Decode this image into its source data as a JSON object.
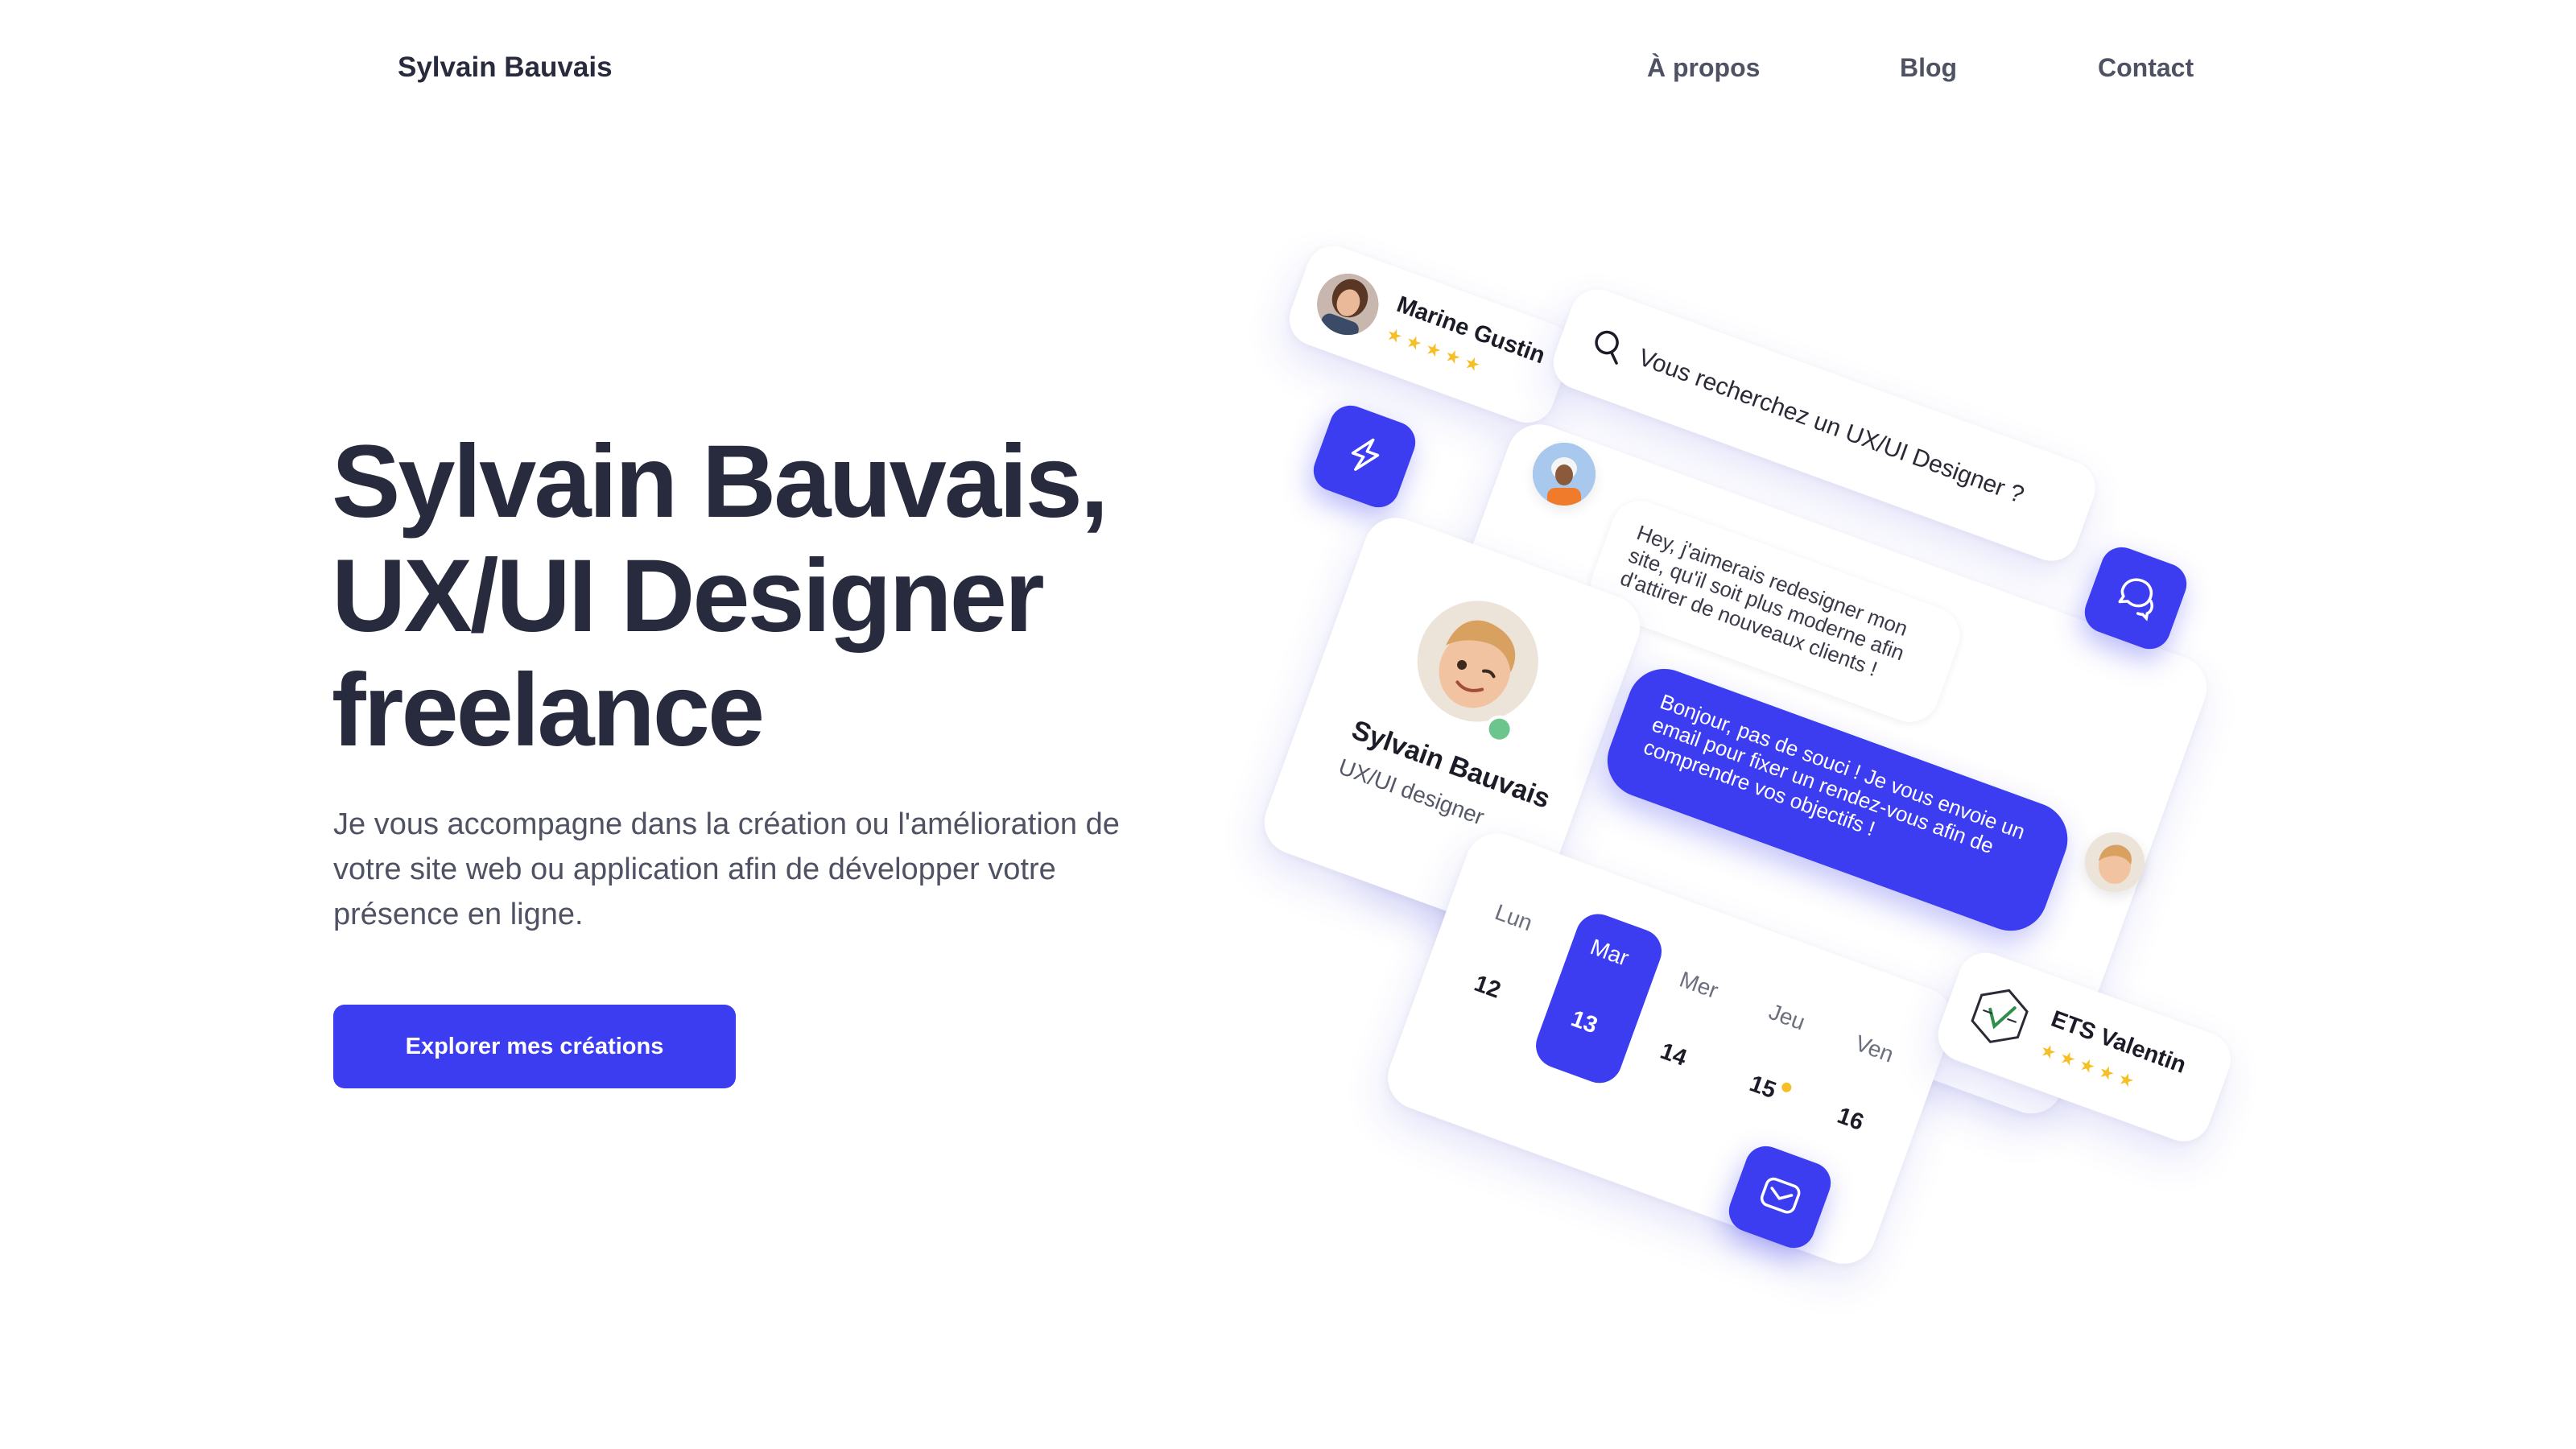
{
  "header": {
    "brand": "Sylvain Bauvais",
    "nav": [
      "À propos",
      "Blog",
      "Contact"
    ]
  },
  "hero": {
    "title_lines": [
      "Sylvain Bauvais,",
      "UX/UI Designer",
      "freelance"
    ],
    "subtitle": "Je vous accompagne dans la création ou l'amélioration de votre site web ou application afin de développer votre présence en ligne.",
    "cta_label": "Explorer mes créations"
  },
  "illustration": {
    "review_top": {
      "name": "Marine Gustin",
      "stars": "★★★★★",
      "rating": 5
    },
    "search": {
      "text": "Vous recherchez un UX/UI Designer ?",
      "icon": "search-icon"
    },
    "profile": {
      "name": "Sylvain Bauvais",
      "role": "UX/UI designer",
      "status": "online"
    },
    "message_in": "Hey, j'aimerais redesigner mon site, qu'il soit plus moderne afin d'attirer de nouveaux clients !",
    "message_out": "Bonjour, pas de souci ! Je vous envoie un email pour fixer un rendez-vous afin de comprendre vos objectifs !",
    "calendar": {
      "days": [
        "Lun",
        "Mar",
        "Mer",
        "Jeu",
        "Ven"
      ],
      "dates": [
        "12",
        "13",
        "14",
        "15",
        "16"
      ],
      "selected": "13"
    },
    "review_bottom": {
      "name": "ETS Valentin",
      "stars": "★★★★★",
      "rating": 5
    },
    "icons": [
      "lightning-icon",
      "chat-bubbles-icon",
      "mail-icon"
    ]
  },
  "colors": {
    "accent": "#3c3cf0",
    "text_dark": "#282a3d",
    "text_muted": "#4f5262",
    "star": "#f6bf26",
    "online": "#6cc58d"
  }
}
